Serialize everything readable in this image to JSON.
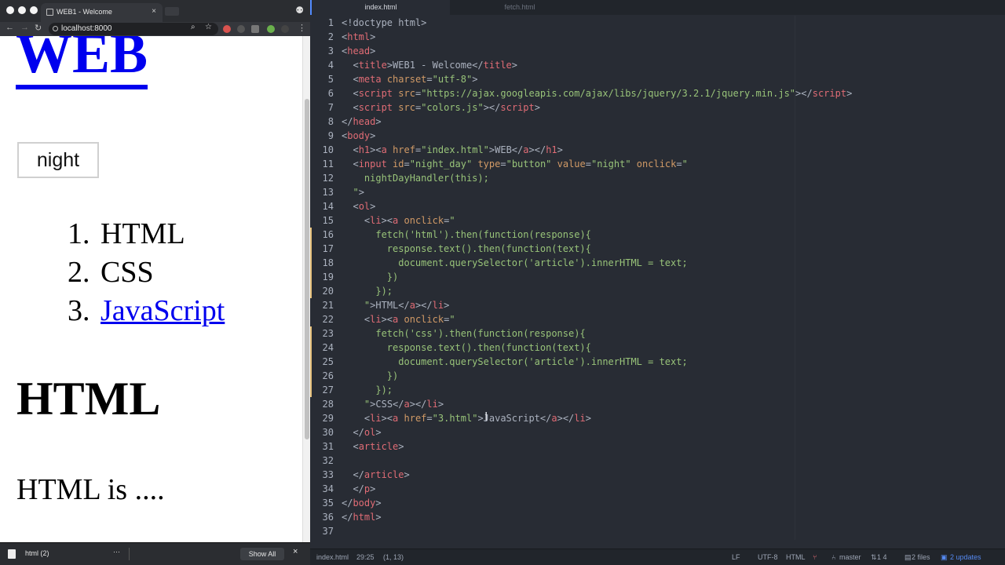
{
  "browser": {
    "tab_title": "WEB1 - Welcome",
    "tab_close": "×",
    "url": "localhost:8000",
    "incognito_icon": "incognito-icon",
    "page": {
      "h1_link": "WEB",
      "night_button": "night",
      "nav": [
        {
          "num": "1.",
          "label": "HTML"
        },
        {
          "num": "2.",
          "label": "CSS"
        },
        {
          "num": "3.",
          "label": "JavaScript"
        }
      ],
      "article_title": "HTML",
      "article_body": "HTML is ...."
    }
  },
  "downloads": {
    "file_name": "html (2)",
    "more": "···",
    "show_all": "Show All",
    "close": "×"
  },
  "editor": {
    "tabs": [
      "index.html",
      "fetch.html"
    ],
    "lines": [
      {
        "n": "1",
        "mod": false,
        "tokens": [
          [
            "pun",
            "<!doctype html>"
          ]
        ]
      },
      {
        "n": "2",
        "mod": false,
        "tokens": [
          [
            "pun",
            "<"
          ],
          [
            "tag",
            "html"
          ],
          [
            "pun",
            ">"
          ]
        ]
      },
      {
        "n": "3",
        "mod": false,
        "tokens": [
          [
            "pun",
            "<"
          ],
          [
            "tag",
            "head"
          ],
          [
            "pun",
            ">"
          ]
        ]
      },
      {
        "n": "4",
        "mod": false,
        "tokens": [
          [
            "pun",
            "  <"
          ],
          [
            "tag",
            "title"
          ],
          [
            "pun",
            ">WEB1 - Welcome</"
          ],
          [
            "tag",
            "title"
          ],
          [
            "pun",
            ">"
          ]
        ]
      },
      {
        "n": "5",
        "mod": false,
        "tokens": [
          [
            "pun",
            "  <"
          ],
          [
            "tag",
            "meta"
          ],
          [
            "pun",
            " "
          ],
          [
            "attr",
            "charset"
          ],
          [
            "pun",
            "="
          ],
          [
            "str",
            "\"utf-8\""
          ],
          [
            "pun",
            ">"
          ]
        ]
      },
      {
        "n": "6",
        "mod": false,
        "tokens": [
          [
            "pun",
            "  <"
          ],
          [
            "tag",
            "script"
          ],
          [
            "pun",
            " "
          ],
          [
            "attr",
            "src"
          ],
          [
            "pun",
            "="
          ],
          [
            "str",
            "\"https://ajax.googleapis.com/ajax/libs/jquery/3.2.1/jquery.min.js\""
          ],
          [
            "pun",
            "></"
          ],
          [
            "tag",
            "script"
          ],
          [
            "pun",
            ">"
          ]
        ]
      },
      {
        "n": "7",
        "mod": false,
        "tokens": [
          [
            "pun",
            "  <"
          ],
          [
            "tag",
            "script"
          ],
          [
            "pun",
            " "
          ],
          [
            "attr",
            "src"
          ],
          [
            "pun",
            "="
          ],
          [
            "str",
            "\"colors.js\""
          ],
          [
            "pun",
            "></"
          ],
          [
            "tag",
            "script"
          ],
          [
            "pun",
            ">"
          ]
        ]
      },
      {
        "n": "8",
        "mod": false,
        "tokens": [
          [
            "pun",
            "</"
          ],
          [
            "tag",
            "head"
          ],
          [
            "pun",
            ">"
          ]
        ]
      },
      {
        "n": "9",
        "mod": false,
        "tokens": [
          [
            "pun",
            "<"
          ],
          [
            "tag",
            "body"
          ],
          [
            "pun",
            ">"
          ]
        ]
      },
      {
        "n": "10",
        "mod": false,
        "tokens": [
          [
            "pun",
            "  <"
          ],
          [
            "tag",
            "h1"
          ],
          [
            "pun",
            "><"
          ],
          [
            "tag",
            "a"
          ],
          [
            "pun",
            " "
          ],
          [
            "attr",
            "href"
          ],
          [
            "pun",
            "="
          ],
          [
            "str",
            "\"index.html\""
          ],
          [
            "pun",
            ">WEB</"
          ],
          [
            "tag",
            "a"
          ],
          [
            "pun",
            "></"
          ],
          [
            "tag",
            "h1"
          ],
          [
            "pun",
            ">"
          ]
        ]
      },
      {
        "n": "11",
        "mod": false,
        "tokens": [
          [
            "pun",
            "  <"
          ],
          [
            "tag",
            "input"
          ],
          [
            "pun",
            " "
          ],
          [
            "attr",
            "id"
          ],
          [
            "pun",
            "="
          ],
          [
            "str",
            "\"night_day\""
          ],
          [
            "pun",
            " "
          ],
          [
            "attr",
            "type"
          ],
          [
            "pun",
            "="
          ],
          [
            "str",
            "\"button\""
          ],
          [
            "pun",
            " "
          ],
          [
            "attr",
            "value"
          ],
          [
            "pun",
            "="
          ],
          [
            "str",
            "\"night\""
          ],
          [
            "pun",
            " "
          ],
          [
            "attr",
            "onclick"
          ],
          [
            "pun",
            "="
          ],
          [
            "str",
            "\""
          ]
        ]
      },
      {
        "n": "12",
        "mod": false,
        "tokens": [
          [
            "pun",
            "    "
          ],
          [
            "str",
            "nightDayHandler(this);"
          ]
        ]
      },
      {
        "n": "13",
        "mod": false,
        "tokens": [
          [
            "pun",
            "  "
          ],
          [
            "str",
            "\""
          ],
          [
            "pun",
            ">"
          ]
        ]
      },
      {
        "n": "14",
        "mod": false,
        "tokens": [
          [
            "pun",
            "  <"
          ],
          [
            "tag",
            "ol"
          ],
          [
            "pun",
            ">"
          ]
        ]
      },
      {
        "n": "15",
        "mod": false,
        "tokens": [
          [
            "pun",
            "    <"
          ],
          [
            "tag",
            "li"
          ],
          [
            "pun",
            "><"
          ],
          [
            "tag",
            "a"
          ],
          [
            "pun",
            " "
          ],
          [
            "attr",
            "onclick"
          ],
          [
            "pun",
            "="
          ],
          [
            "str",
            "\""
          ]
        ]
      },
      {
        "n": "16",
        "mod": true,
        "tokens": [
          [
            "pun",
            "      "
          ],
          [
            "str",
            "fetch('html').then(function(response){"
          ]
        ]
      },
      {
        "n": "17",
        "mod": true,
        "tokens": [
          [
            "pun",
            "        "
          ],
          [
            "str",
            "response.text().then(function(text){"
          ]
        ]
      },
      {
        "n": "18",
        "mod": true,
        "tokens": [
          [
            "pun",
            "          "
          ],
          [
            "str",
            "document.querySelector('article').innerHTML = text;"
          ]
        ]
      },
      {
        "n": "19",
        "mod": true,
        "tokens": [
          [
            "pun",
            "        "
          ],
          [
            "str",
            "})"
          ]
        ]
      },
      {
        "n": "20",
        "mod": true,
        "tokens": [
          [
            "pun",
            "      "
          ],
          [
            "str",
            "});"
          ]
        ]
      },
      {
        "n": "21",
        "mod": false,
        "tokens": [
          [
            "pun",
            "    "
          ],
          [
            "str",
            "\""
          ],
          [
            "pun",
            ">HTML</"
          ],
          [
            "tag",
            "a"
          ],
          [
            "pun",
            "></"
          ],
          [
            "tag",
            "li"
          ],
          [
            "pun",
            ">"
          ]
        ]
      },
      {
        "n": "22",
        "mod": false,
        "tokens": [
          [
            "pun",
            "    <"
          ],
          [
            "tag",
            "li"
          ],
          [
            "pun",
            "><"
          ],
          [
            "tag",
            "a"
          ],
          [
            "pun",
            " "
          ],
          [
            "attr",
            "onclick"
          ],
          [
            "pun",
            "="
          ],
          [
            "str",
            "\""
          ]
        ]
      },
      {
        "n": "23",
        "mod": true,
        "tokens": [
          [
            "pun",
            "      "
          ],
          [
            "str",
            "fetch('css').then(function(response){"
          ]
        ]
      },
      {
        "n": "24",
        "mod": true,
        "tokens": [
          [
            "pun",
            "        "
          ],
          [
            "str",
            "response.text().then(function(text){"
          ]
        ]
      },
      {
        "n": "25",
        "mod": true,
        "tokens": [
          [
            "pun",
            "          "
          ],
          [
            "str",
            "document.querySelector('article').innerHTML = text;"
          ]
        ]
      },
      {
        "n": "26",
        "mod": true,
        "tokens": [
          [
            "pun",
            "        "
          ],
          [
            "str",
            "})"
          ]
        ]
      },
      {
        "n": "27",
        "mod": true,
        "tokens": [
          [
            "pun",
            "      "
          ],
          [
            "str",
            "});"
          ]
        ]
      },
      {
        "n": "28",
        "mod": false,
        "tokens": [
          [
            "pun",
            "    "
          ],
          [
            "str",
            "\""
          ],
          [
            "pun",
            ">CSS</"
          ],
          [
            "tag",
            "a"
          ],
          [
            "pun",
            "></"
          ],
          [
            "tag",
            "li"
          ],
          [
            "pun",
            ">"
          ]
        ]
      },
      {
        "n": "29",
        "mod": false,
        "tokens": [
          [
            "pun",
            "    <"
          ],
          [
            "tag",
            "li"
          ],
          [
            "pun",
            "><"
          ],
          [
            "tag",
            "a"
          ],
          [
            "pun",
            " "
          ],
          [
            "attr",
            "href"
          ],
          [
            "pun",
            "="
          ],
          [
            "str",
            "\"3.html\""
          ],
          [
            "pun",
            ">JavaScript</"
          ],
          [
            "tag",
            "a"
          ],
          [
            "pun",
            "></"
          ],
          [
            "tag",
            "li"
          ],
          [
            "pun",
            ">"
          ]
        ]
      },
      {
        "n": "30",
        "mod": false,
        "tokens": [
          [
            "pun",
            "  </"
          ],
          [
            "tag",
            "ol"
          ],
          [
            "pun",
            ">"
          ]
        ]
      },
      {
        "n": "31",
        "mod": false,
        "tokens": [
          [
            "pun",
            "  <"
          ],
          [
            "tag",
            "article"
          ],
          [
            "pun",
            ">"
          ]
        ]
      },
      {
        "n": "32",
        "mod": false,
        "tokens": [
          [
            "pun",
            ""
          ]
        ]
      },
      {
        "n": "33",
        "mod": false,
        "tokens": [
          [
            "pun",
            "  </"
          ],
          [
            "tag",
            "article"
          ],
          [
            "pun",
            ">"
          ]
        ]
      },
      {
        "n": "34",
        "mod": false,
        "tokens": [
          [
            "pun",
            "  </"
          ],
          [
            "tag",
            "p"
          ],
          [
            "pun",
            ">"
          ]
        ]
      },
      {
        "n": "35",
        "mod": false,
        "tokens": [
          [
            "pun",
            "</"
          ],
          [
            "tag",
            "body"
          ],
          [
            "pun",
            ">"
          ]
        ]
      },
      {
        "n": "36",
        "mod": false,
        "tokens": [
          [
            "pun",
            "</"
          ],
          [
            "tag",
            "html"
          ],
          [
            "pun",
            ">"
          ]
        ]
      },
      {
        "n": "37",
        "mod": false,
        "tokens": [
          [
            "pun",
            ""
          ]
        ]
      }
    ],
    "status": {
      "file": "index.html",
      "cursor": "29:25",
      "selection": "(1, 13)",
      "line_ending": "LF",
      "encoding": "UTF-8",
      "grammar": "HTML",
      "branch": "master",
      "sync": "1  4",
      "files": "2 files",
      "updates": "2 updates"
    }
  },
  "colors": {
    "editor_bg": "#282c34",
    "tag": "#e06c75",
    "attr": "#d19a66",
    "string": "#98c379",
    "link": "#0000ee",
    "accent": "#568af2"
  }
}
